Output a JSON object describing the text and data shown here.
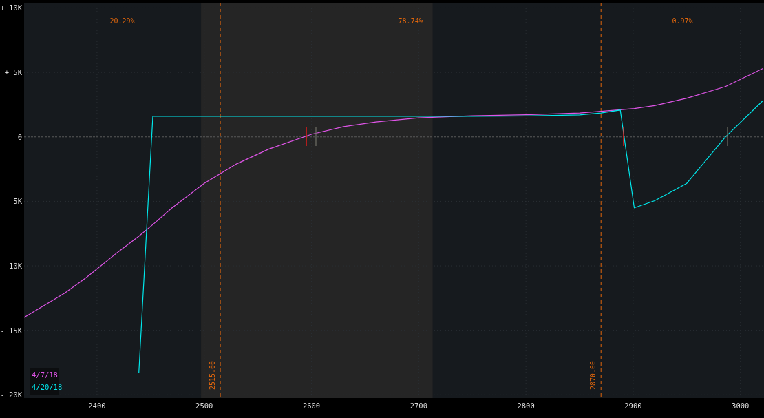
{
  "chart_data": {
    "type": "line",
    "grid": true,
    "xlim": [
      2332,
      3022
    ],
    "ylim": [
      -20250,
      10400
    ],
    "xticks": [
      2400,
      2500,
      2600,
      2700,
      2800,
      2900,
      3000
    ],
    "yticks": [
      {
        "value": 10000,
        "label": "+ 10K"
      },
      {
        "value": 5000,
        "label": "+ 5K"
      },
      {
        "value": 0,
        "label": "0"
      },
      {
        "value": -5000,
        "label": "- 5K"
      },
      {
        "value": -10000,
        "label": "- 10K"
      },
      {
        "value": -15000,
        "label": "- 15K"
      },
      {
        "value": -20000,
        "label": "- 20K"
      }
    ],
    "x": [
      2332,
      2370,
      2390,
      2420,
      2439,
      2452,
      2470,
      2500,
      2530,
      2560,
      2600,
      2630,
      2660,
      2700,
      2750,
      2800,
      2850,
      2870,
      2888,
      2901,
      2920,
      2950,
      2986,
      3021
    ],
    "series": [
      {
        "name": "4/7/18",
        "color": "#e055e8",
        "values": [
          -14000,
          -12100,
          -10900,
          -8900,
          -7700,
          -6800,
          -5500,
          -3600,
          -2100,
          -950,
          200,
          800,
          1150,
          1470,
          1630,
          1720,
          1850,
          1980,
          2100,
          2200,
          2420,
          3000,
          3900,
          5300
        ]
      },
      {
        "name": "4/20/18",
        "color": "#00e8ec",
        "values": [
          -18300,
          -18300,
          -18300,
          -18300,
          -18300,
          1600,
          1600,
          1600,
          1600,
          1600,
          1600,
          1600,
          1600,
          1600,
          1600,
          1620,
          1700,
          1850,
          2080,
          -5500,
          -4950,
          -3600,
          0,
          2800
        ]
      }
    ],
    "bands": [
      {
        "axis": "x",
        "from": 2497,
        "to": 2713
      }
    ],
    "ref_lines": [
      {
        "axis": "y",
        "value": 0
      },
      {
        "axis": "x",
        "value": 2515,
        "label": "2515.00"
      },
      {
        "axis": "x",
        "value": 2870,
        "label": "2870.00"
      }
    ],
    "annotations": [
      "20.29%",
      "78.74%",
      "0.97%"
    ]
  }
}
